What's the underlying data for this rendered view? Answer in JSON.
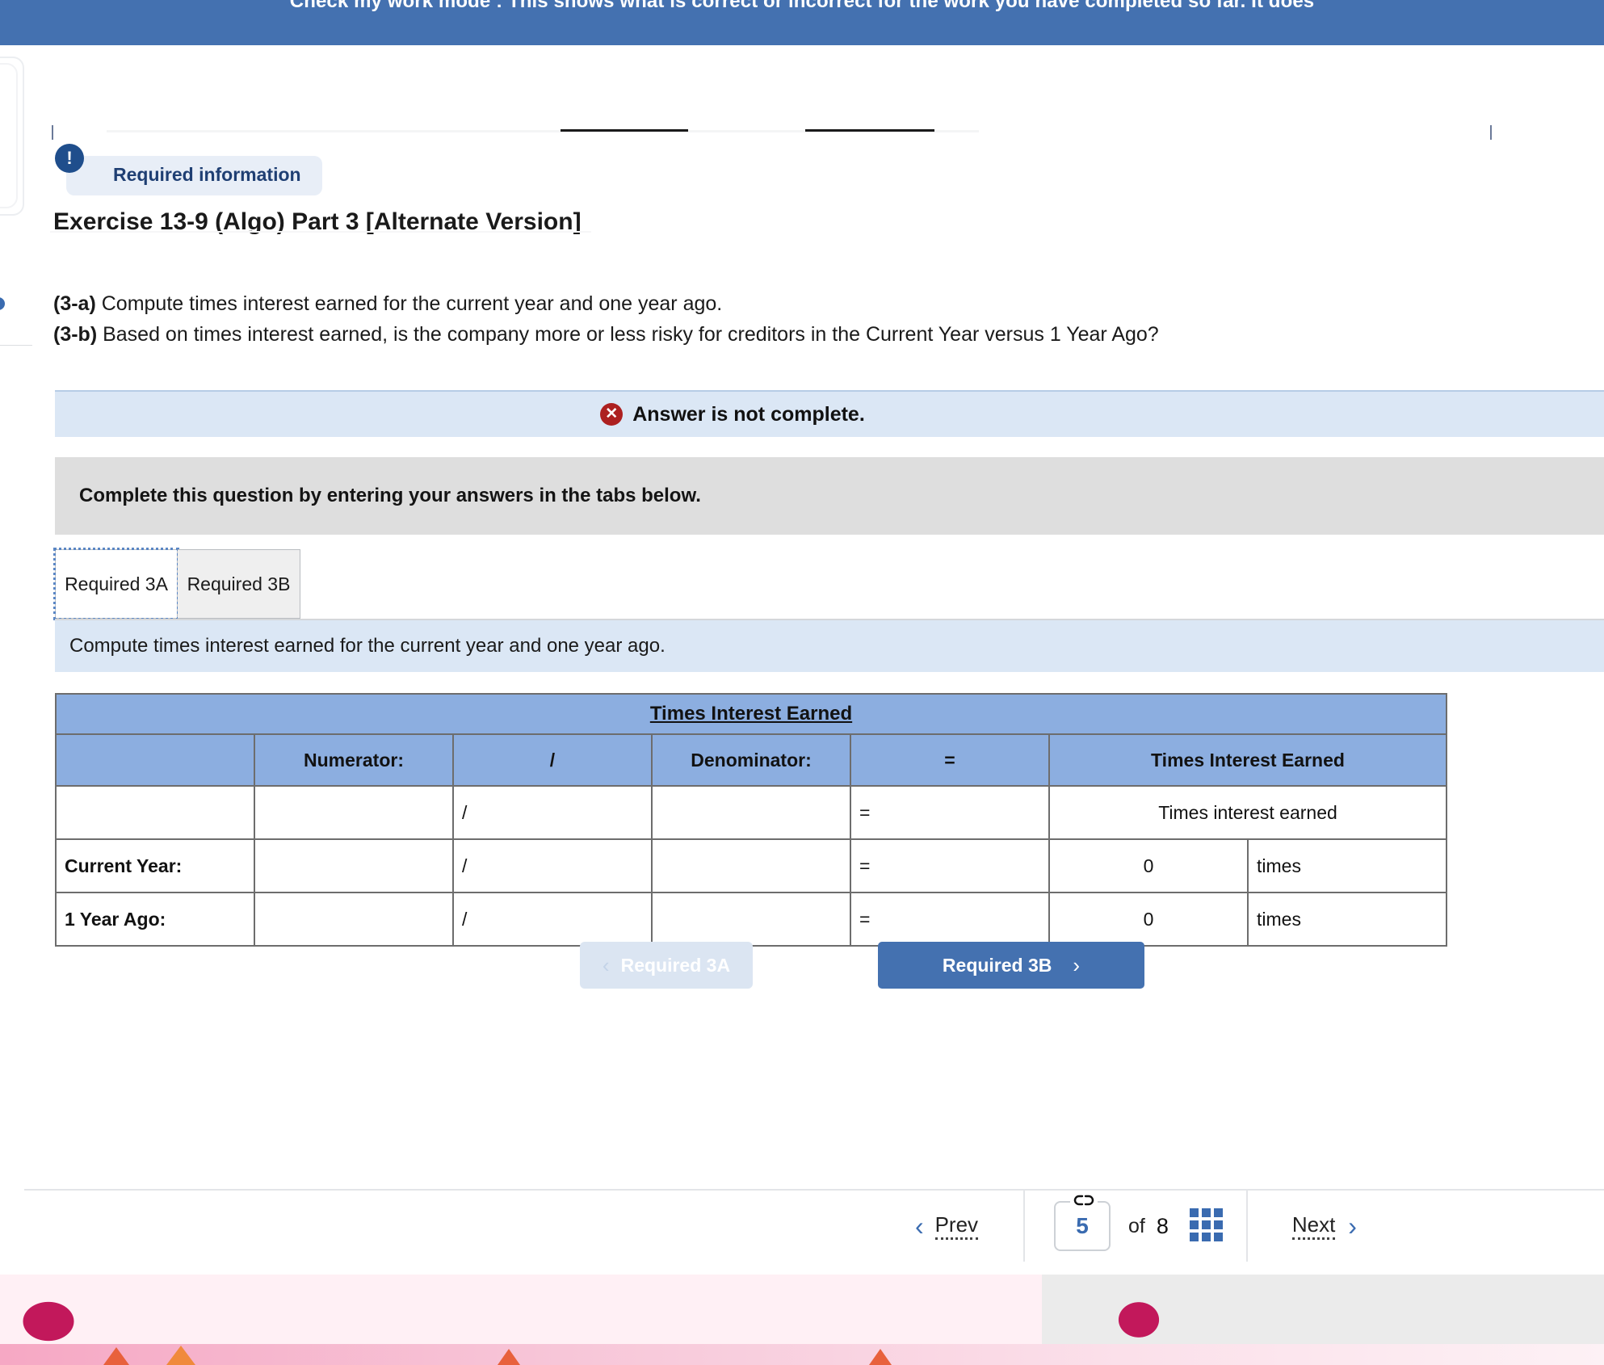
{
  "banner": {
    "text": "Check my work mode : This shows what is correct or incorrect for the work you have completed so far. It does"
  },
  "required_info": {
    "badge": "!",
    "label": "Required information"
  },
  "exercise": {
    "title": "Exercise 13-9 (Algo) Part 3 [Alternate Version]",
    "question_a_label": "(3-a)",
    "question_a_text": " Compute times interest earned for the current year and one year ago.",
    "question_b_label": "(3-b)",
    "question_b_text": " Based on times interest earned, is the company more or less risky for creditors in the Current Year versus 1 Year Ago?"
  },
  "notice": {
    "icon": "✕",
    "text": "Answer is not complete."
  },
  "instruction": {
    "text": "Complete this question by entering your answers in the tabs below."
  },
  "tabs": [
    {
      "label": "Required 3A",
      "active": true
    },
    {
      "label": "Required 3B",
      "active": false
    }
  ],
  "subprompt": {
    "text": "Compute times interest earned for the current year and one year ago."
  },
  "table": {
    "title": "Times Interest Earned",
    "headers": {
      "blank": "",
      "numerator": "Numerator:",
      "slash": "/",
      "denominator": "Denominator:",
      "equals": "=",
      "result": "Times Interest Earned"
    },
    "rows": [
      {
        "label": "",
        "numerator": "",
        "slash": "/",
        "denominator": "",
        "equals": "=",
        "result": "Times interest earned",
        "unit": ""
      },
      {
        "label": "Current Year:",
        "numerator": "",
        "slash": "/",
        "denominator": "",
        "equals": "=",
        "result": "0",
        "unit": "times"
      },
      {
        "label": "1 Year Ago:",
        "numerator": "",
        "slash": "/",
        "denominator": "",
        "equals": "=",
        "result": "0",
        "unit": "times"
      }
    ]
  },
  "nav_buttons": {
    "prev_label": "Required 3A",
    "prev_icon": "‹",
    "next_label": "Required 3B",
    "next_icon": "›"
  },
  "pagination": {
    "prev_label": "Prev",
    "prev_icon": "‹",
    "current_page": "5",
    "of_label": "of",
    "total_pages": "8",
    "link_icon": "link-icon",
    "grid_icon": "grid-icon",
    "next_label": "Next",
    "next_icon": "›"
  },
  "colors": {
    "banner_blue": "#4471b0",
    "table_header_blue": "#8caee0",
    "notice_blue": "#dbe7f5",
    "instruction_gray": "#dedede",
    "button_blue": "#4471b0",
    "error_red": "#ad2020",
    "accent_pink": "#d81b60"
  }
}
